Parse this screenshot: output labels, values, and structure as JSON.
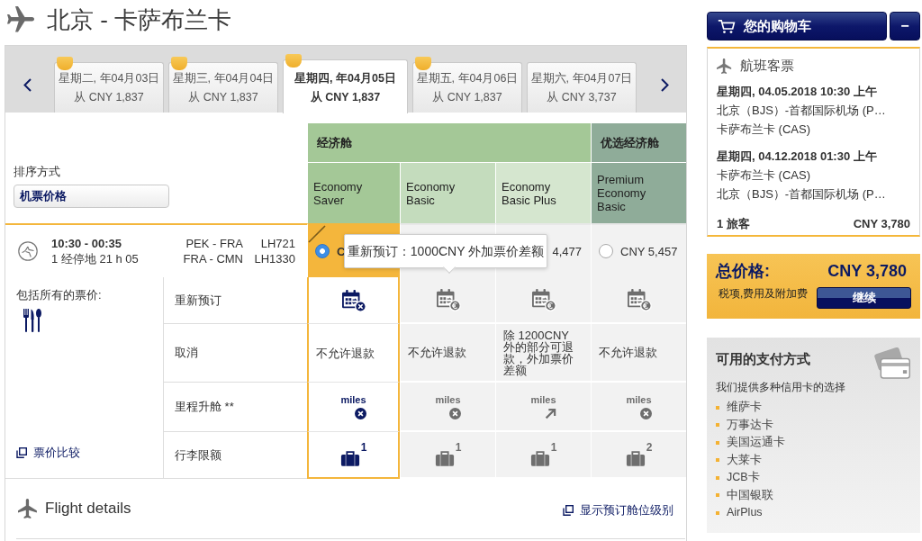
{
  "header": {
    "title": "北京 - 卡萨布兰卡"
  },
  "date_tabs": [
    {
      "date": "星期二, 年04月03日",
      "price": "从 CNY 1,837",
      "selected": false,
      "flagged": true
    },
    {
      "date": "星期三, 年04月04日",
      "price": "从 CNY 1,837",
      "selected": false,
      "flagged": true
    },
    {
      "date": "星期四, 年04月05日",
      "price": "从 CNY 1,837",
      "selected": true,
      "flagged": true
    },
    {
      "date": "星期五, 年04月06日",
      "price": "从 CNY 1,837",
      "selected": false,
      "flagged": true
    },
    {
      "date": "星期六, 年04月07日",
      "price": "从 CNY 3,737",
      "selected": false,
      "flagged": false
    }
  ],
  "sort": {
    "label": "排序方式",
    "value": "机票价格"
  },
  "cabins": [
    {
      "name": "经济舱",
      "color": "#a4c897",
      "fares": [
        {
          "name": "Economy Saver",
          "color": "#a4c897"
        },
        {
          "name": "Economy Basic",
          "color": "#c4dcbd"
        },
        {
          "name": "Economy Basic Plus",
          "color": "#d5e6cf"
        }
      ]
    },
    {
      "name": "优选经济舱",
      "color": "#8fac99",
      "fares": [
        {
          "name": "Premium Economy Basic",
          "color": "#8fac99"
        }
      ]
    }
  ],
  "flight": {
    "times": "10:30 - 00:35",
    "stops": "1 经停地 21 h 05",
    "segments": [
      {
        "route": "PEK - FRA",
        "flight_number": "LH721"
      },
      {
        "route": "FRA - CMN",
        "flight_number": "LH1330"
      }
    ],
    "options": [
      {
        "kind": "radio",
        "selected": true,
        "price": "C"
      },
      {
        "kind": "text",
        "selected": false
      },
      {
        "kind": "text",
        "selected": false,
        "price": "4,477"
      },
      {
        "kind": "radio",
        "selected": false,
        "price": "CNY 5,457"
      }
    ],
    "tooltip": "重新预订：1000CNY 外加票价差额"
  },
  "features": {
    "title": "包括所有的票价:",
    "compare_link": "票价比较",
    "rows": [
      {
        "label": "重新预订",
        "kind": "rebook",
        "cells": [
          {
            "allowed": false
          },
          {
            "allowed": true
          },
          {
            "allowed": true
          },
          {
            "allowed": true
          }
        ]
      },
      {
        "label": "取消",
        "kind": "text",
        "cells": [
          {
            "text": "不允许退款"
          },
          {
            "text": "不允许退款"
          },
          {
            "text": "除 1200CNY 外的部分可退款，外加票价差额"
          },
          {
            "text": "不允许退款"
          }
        ]
      },
      {
        "label": "里程升舱 **",
        "kind": "miles",
        "cells": [
          {
            "text": "miles",
            "allowed": false
          },
          {
            "text": "miles",
            "allowed": false
          },
          {
            "text": "miles",
            "allowed": true
          },
          {
            "text": "miles",
            "allowed": false
          }
        ]
      },
      {
        "label": "行李限额",
        "kind": "baggage",
        "cells": [
          {
            "count": "1"
          },
          {
            "count": "1"
          },
          {
            "count": "1"
          },
          {
            "count": "2"
          }
        ]
      }
    ]
  },
  "flight_details": {
    "title": "Flight details",
    "link": "显示预订舱位级别"
  },
  "cart": {
    "title": "您的购物车",
    "collapse": "−",
    "section": "航班客票",
    "segments": [
      {
        "date": "星期四, 04.05.2018 10:30 上午",
        "from": "北京（BJS）-首都国际机场 (P…",
        "to": "卡萨布兰卡 (CAS)"
      },
      {
        "date": "星期四, 04.12.2018 01:30 上午",
        "from": "卡萨布兰卡 (CAS)",
        "to": "北京（BJS）-首都国际机场 (P…"
      }
    ],
    "passengers": "1 旅客",
    "subtotal": "CNY 3,780"
  },
  "total": {
    "label": "总价格:",
    "amount": "CNY 3,780",
    "note": "税项,费用及附加费",
    "button": "继续"
  },
  "payment": {
    "title": "可用的支付方式",
    "subtitle": "我们提供多种信用卡的选择",
    "methods": [
      "维萨卡",
      "万事达卡",
      "美国运通卡",
      "大莱卡",
      "JCB卡",
      "中国银联",
      "AirPlus"
    ]
  }
}
